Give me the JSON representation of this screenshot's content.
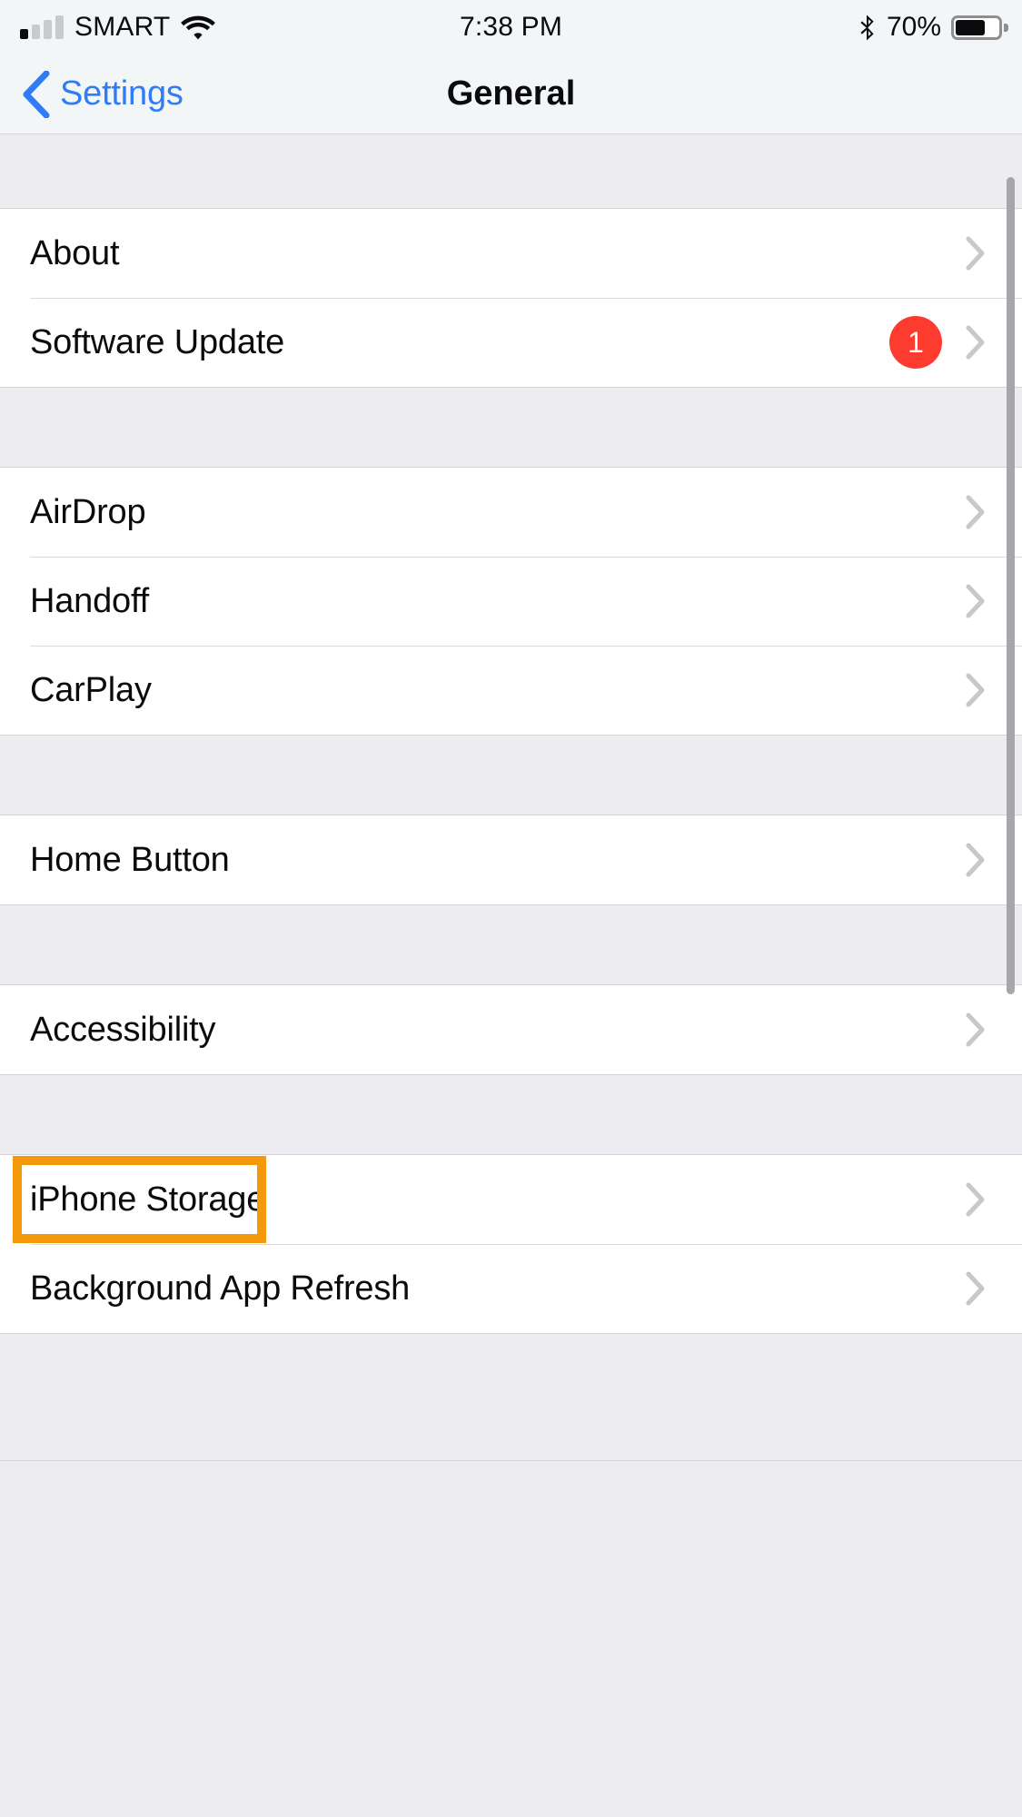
{
  "status_bar": {
    "carrier": "SMART",
    "signal_icon": "cellular-signal-icon",
    "wifi_icon": "wifi-icon",
    "time": "7:38 PM",
    "bluetooth_icon": "bluetooth-icon",
    "battery_percent": "70%",
    "battery_level": 70,
    "battery_icon": "battery-icon"
  },
  "nav_bar": {
    "back_icon": "chevron-left-icon",
    "back_label": "Settings",
    "title": "General"
  },
  "colors": {
    "accent_blue": "#2f7cf6",
    "badge_red": "#fd3b2f",
    "annotation_orange": "#f4980c",
    "row_background": "#ffffff",
    "group_gap": "#ececf1",
    "chevron_gray": "#c7c7cc"
  },
  "groups": [
    {
      "rows": [
        {
          "label": "About",
          "chevron": "chevron-right-icon",
          "badge": null
        },
        {
          "label": "Software Update",
          "chevron": "chevron-right-icon",
          "badge": "1"
        }
      ]
    },
    {
      "rows": [
        {
          "label": "AirDrop",
          "chevron": "chevron-right-icon",
          "badge": null
        },
        {
          "label": "Handoff",
          "chevron": "chevron-right-icon",
          "badge": null
        },
        {
          "label": "CarPlay",
          "chevron": "chevron-right-icon",
          "badge": null
        }
      ]
    },
    {
      "rows": [
        {
          "label": "Home Button",
          "chevron": "chevron-right-icon",
          "badge": null
        }
      ]
    },
    {
      "rows": [
        {
          "label": "Accessibility",
          "chevron": "chevron-right-icon",
          "badge": null
        }
      ]
    },
    {
      "rows": [
        {
          "label": "iPhone Storage",
          "chevron": "chevron-right-icon",
          "badge": null,
          "highlighted": true
        },
        {
          "label": "Background App Refresh",
          "chevron": "chevron-right-icon",
          "badge": null
        }
      ]
    }
  ],
  "annotation": {
    "target": "iPhone Storage",
    "shape": "rectangle"
  }
}
